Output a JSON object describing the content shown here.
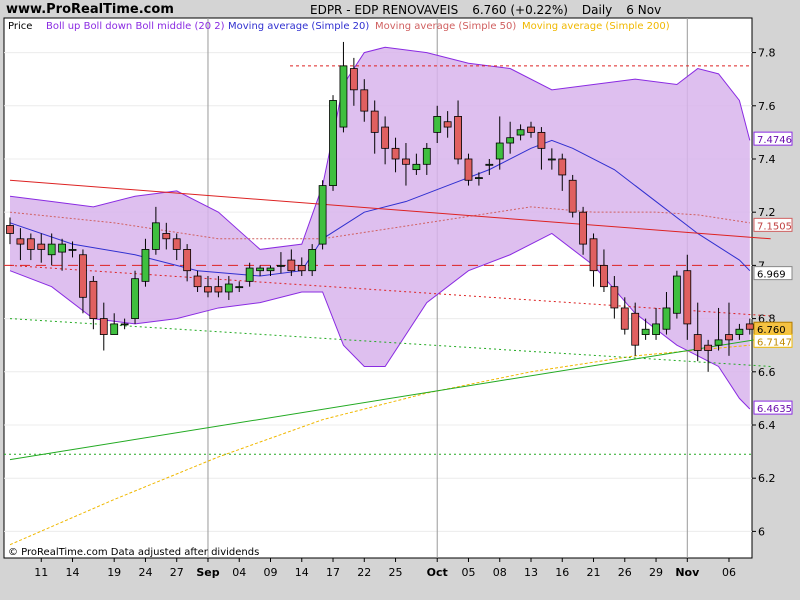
{
  "header": {
    "site": "www.ProRealTime.com",
    "symbol": "EDPR - EDP RENOVAVEIS",
    "quote": "6.760 (+0.22%)",
    "period": "Daily",
    "date": "6 Nov"
  },
  "legend": {
    "price": "Price",
    "bollinger": "Boll up Boll down Boll middle (20 2)",
    "ma20": "Moving average (Simple 20)",
    "ma50": "Moving average (Simple 50)",
    "ma200": "Moving average (Simple 200)"
  },
  "footer": "© ProRealTime.com  Data adjusted after dividends",
  "colors": {
    "up": "#3fbf3f",
    "down": "#e06060",
    "band_fill": "#d8b4ec",
    "band_line": "#8a2be2",
    "ma20": "#3030d0",
    "ma50": "#d06060",
    "ma200": "#f0b800",
    "trend_red": "#dd2222",
    "trend_green": "#22aa22"
  },
  "chart_data": {
    "type": "candlestick",
    "ylim": [
      5.9,
      7.93
    ],
    "y_ticks": [
      "7.8",
      "7.6",
      "7.4",
      "7.2",
      "7",
      "6.8",
      "6.6",
      "6.4",
      "6.2",
      "6"
    ],
    "x_ticks": [
      "11",
      "14",
      "19",
      "24",
      "27",
      "Sep",
      "04",
      "09",
      "14",
      "17",
      "22",
      "25",
      "Oct",
      "05",
      "08",
      "13",
      "16",
      "21",
      "26",
      "29",
      "Nov",
      "06"
    ],
    "price_labels": [
      {
        "text": "7.4746",
        "value": 7.4746,
        "style": "band"
      },
      {
        "text": "7.1505",
        "value": 7.1505,
        "style": "ma50"
      },
      {
        "text": "6.969",
        "value": 6.969,
        "style": "plain"
      },
      {
        "text": "6.760",
        "value": 6.76,
        "style": "last"
      },
      {
        "text": "6.7147",
        "value": 6.7147,
        "style": "ma200"
      },
      {
        "text": "6.4635",
        "value": 6.4635,
        "style": "band"
      }
    ],
    "hlines": [
      {
        "value": 7.75,
        "color": "#dd2222",
        "dash": "3,3"
      },
      {
        "value": 7.0,
        "color": "#dd2222",
        "dash": "10,6"
      },
      {
        "value": 6.29,
        "color": "#22aa22",
        "dash": "2,3"
      }
    ],
    "candles": [
      [
        7.15,
        7.12,
        7.18,
        7.08
      ],
      [
        7.1,
        7.08,
        7.14,
        7.02
      ],
      [
        7.1,
        7.06,
        7.12,
        7.02
      ],
      [
        7.08,
        7.06,
        7.12,
        7.01
      ],
      [
        7.04,
        7.08,
        7.12,
        7.0
      ],
      [
        7.05,
        7.08,
        7.1,
        6.98
      ],
      [
        7.06,
        7.06,
        7.09,
        7.03
      ],
      [
        7.04,
        6.88,
        7.06,
        6.82
      ],
      [
        6.94,
        6.8,
        6.96,
        6.76
      ],
      [
        6.8,
        6.74,
        6.86,
        6.68
      ],
      [
        6.74,
        6.78,
        6.82,
        6.74
      ],
      [
        6.78,
        6.78,
        6.8,
        6.76
      ],
      [
        6.8,
        6.95,
        6.98,
        6.78
      ],
      [
        6.94,
        7.06,
        7.1,
        6.92
      ],
      [
        7.06,
        7.16,
        7.22,
        7.04
      ],
      [
        7.12,
        7.1,
        7.16,
        7.06
      ],
      [
        7.1,
        7.06,
        7.12,
        7.02
      ],
      [
        7.06,
        6.98,
        7.08,
        6.94
      ],
      [
        6.96,
        6.92,
        6.98,
        6.9
      ],
      [
        6.92,
        6.9,
        6.96,
        6.88
      ],
      [
        6.92,
        6.9,
        6.96,
        6.88
      ],
      [
        6.9,
        6.93,
        6.96,
        6.87
      ],
      [
        6.92,
        6.92,
        6.94,
        6.9
      ],
      [
        6.94,
        6.99,
        7.01,
        6.92
      ],
      [
        6.98,
        6.99,
        7.0,
        6.96
      ],
      [
        6.98,
        6.99,
        7.0,
        6.96
      ],
      [
        7.0,
        7.0,
        7.05,
        6.97
      ],
      [
        7.02,
        6.98,
        7.06,
        6.96
      ],
      [
        7.0,
        6.98,
        7.03,
        6.96
      ],
      [
        6.98,
        7.06,
        7.08,
        6.96
      ],
      [
        7.08,
        7.3,
        7.32,
        7.06
      ],
      [
        7.3,
        7.62,
        7.64,
        7.28
      ],
      [
        7.52,
        7.75,
        7.84,
        7.5
      ],
      [
        7.74,
        7.66,
        7.78,
        7.6
      ],
      [
        7.66,
        7.58,
        7.7,
        7.54
      ],
      [
        7.58,
        7.5,
        7.62,
        7.42
      ],
      [
        7.52,
        7.44,
        7.56,
        7.38
      ],
      [
        7.44,
        7.4,
        7.48,
        7.35
      ],
      [
        7.4,
        7.38,
        7.46,
        7.3
      ],
      [
        7.36,
        7.38,
        7.42,
        7.34
      ],
      [
        7.38,
        7.44,
        7.46,
        7.34
      ],
      [
        7.5,
        7.56,
        7.6,
        7.46
      ],
      [
        7.54,
        7.52,
        7.58,
        7.48
      ],
      [
        7.56,
        7.4,
        7.62,
        7.38
      ],
      [
        7.4,
        7.32,
        7.42,
        7.3
      ],
      [
        7.33,
        7.33,
        7.35,
        7.3
      ],
      [
        7.38,
        7.38,
        7.4,
        7.34
      ],
      [
        7.4,
        7.46,
        7.56,
        7.36
      ],
      [
        7.46,
        7.48,
        7.54,
        7.42
      ],
      [
        7.49,
        7.51,
        7.53,
        7.47
      ],
      [
        7.52,
        7.5,
        7.54,
        7.48
      ],
      [
        7.5,
        7.44,
        7.52,
        7.36
      ],
      [
        7.4,
        7.4,
        7.44,
        7.36
      ],
      [
        7.4,
        7.34,
        7.42,
        7.28
      ],
      [
        7.32,
        7.2,
        7.34,
        7.18
      ],
      [
        7.2,
        7.08,
        7.22,
        7.04
      ],
      [
        7.1,
        6.98,
        7.12,
        6.92
      ],
      [
        7.0,
        6.92,
        7.06,
        6.9
      ],
      [
        6.92,
        6.84,
        6.96,
        6.8
      ],
      [
        6.84,
        6.76,
        6.88,
        6.74
      ],
      [
        6.82,
        6.7,
        6.86,
        6.66
      ],
      [
        6.74,
        6.76,
        6.8,
        6.72
      ],
      [
        6.74,
        6.78,
        6.84,
        6.72
      ],
      [
        6.76,
        6.84,
        6.9,
        6.74
      ],
      [
        6.82,
        6.96,
        6.98,
        6.8
      ],
      [
        6.98,
        6.78,
        7.04,
        6.72
      ],
      [
        6.74,
        6.68,
        6.86,
        6.64
      ],
      [
        6.7,
        6.68,
        6.72,
        6.6
      ],
      [
        6.7,
        6.72,
        6.84,
        6.68
      ],
      [
        6.74,
        6.72,
        6.86,
        6.66
      ],
      [
        6.74,
        6.76,
        6.78,
        6.72
      ],
      [
        6.78,
        6.76,
        6.8,
        6.74
      ]
    ],
    "series": [
      {
        "role": "boll_up",
        "x": [
          0,
          4,
          8,
          12,
          16,
          20,
          24,
          28,
          30,
          32,
          34,
          36,
          40,
          44,
          48,
          52,
          56,
          60,
          64,
          66,
          68,
          70,
          71
        ],
        "values": [
          7.26,
          7.24,
          7.22,
          7.26,
          7.28,
          7.2,
          7.06,
          7.08,
          7.3,
          7.68,
          7.8,
          7.82,
          7.8,
          7.76,
          7.74,
          7.66,
          7.68,
          7.7,
          7.68,
          7.74,
          7.72,
          7.62,
          7.47
        ]
      },
      {
        "role": "boll_down",
        "x": [
          0,
          4,
          8,
          12,
          16,
          20,
          24,
          28,
          30,
          32,
          34,
          36,
          40,
          44,
          48,
          52,
          56,
          60,
          64,
          66,
          68,
          70,
          71
        ],
        "values": [
          6.98,
          6.92,
          6.8,
          6.78,
          6.8,
          6.84,
          6.86,
          6.9,
          6.9,
          6.7,
          6.62,
          6.62,
          6.86,
          6.98,
          7.04,
          7.12,
          7.0,
          6.82,
          6.7,
          6.66,
          6.62,
          6.5,
          6.46
        ]
      },
      {
        "role": "ma20",
        "x": [
          0,
          6,
          12,
          18,
          24,
          28,
          30,
          34,
          38,
          42,
          46,
          50,
          52,
          54,
          58,
          62,
          66,
          70,
          71
        ],
        "values": [
          7.16,
          7.08,
          7.04,
          6.98,
          6.96,
          6.98,
          7.1,
          7.2,
          7.24,
          7.3,
          7.36,
          7.44,
          7.47,
          7.44,
          7.36,
          7.24,
          7.12,
          7.02,
          6.98
        ]
      },
      {
        "role": "ma50",
        "x": [
          0,
          10,
          20,
          30,
          40,
          50,
          56,
          62,
          66,
          71
        ],
        "values": [
          7.2,
          7.16,
          7.1,
          7.1,
          7.16,
          7.22,
          7.2,
          7.2,
          7.19,
          7.16
        ]
      },
      {
        "role": "ma200",
        "x": [
          0,
          10,
          20,
          30,
          40,
          50,
          60,
          71
        ],
        "values": [
          5.95,
          6.12,
          6.28,
          6.42,
          6.52,
          6.6,
          6.66,
          6.7
        ]
      },
      {
        "role": "trend_red",
        "x": [
          0,
          73
        ],
        "values": [
          7.32,
          7.1
        ]
      },
      {
        "role": "trend_red_dot",
        "x": [
          0,
          73
        ],
        "values": [
          7.0,
          6.81
        ]
      },
      {
        "role": "trend_green",
        "x": [
          0,
          73
        ],
        "values": [
          6.27,
          6.73
        ]
      },
      {
        "role": "trend_green_dot",
        "x": [
          0,
          73
        ],
        "values": [
          6.8,
          6.62
        ]
      }
    ]
  }
}
